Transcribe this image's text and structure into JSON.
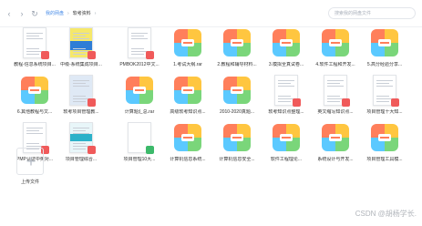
{
  "toolbar": {
    "back_icon": "chevron-left-icon",
    "forward_icon": "chevron-right-icon",
    "refresh_icon": "refresh-icon",
    "breadcrumb": [
      "我的网盘",
      "软考资料"
    ],
    "search_placeholder": "搜索我的网盘文件"
  },
  "files": [
    {
      "name": "教程-信息系统项目...",
      "kind": "doc",
      "cover": "plain"
    },
    {
      "name": "中级-系统集成项目...",
      "kind": "doc",
      "cover": "yellow"
    },
    {
      "name": "PMBOK2012中文...",
      "kind": "doc",
      "cover": "plain"
    },
    {
      "name": "1.考试大纲.rar",
      "kind": "app"
    },
    {
      "name": "2.教程和辅导材料...",
      "kind": "app"
    },
    {
      "name": "3.模拟全真试卷...",
      "kind": "app"
    },
    {
      "name": "4.软件工程和开发...",
      "kind": "app"
    },
    {
      "name": "5.高分经验分享...",
      "kind": "app"
    },
    {
      "name": "6.其他教程与文...",
      "kind": "app"
    },
    {
      "name": "软考项目管理教...",
      "kind": "doc",
      "cover": "blue"
    },
    {
      "name": "计算题汇总.rar",
      "kind": "app"
    },
    {
      "name": "高级软考知识点...",
      "kind": "app"
    },
    {
      "name": "2010-2020真题...",
      "kind": "app"
    },
    {
      "name": "软考知识点整理...",
      "kind": "doc",
      "cover": "plain"
    },
    {
      "name": "英文缩写知识点...",
      "kind": "doc",
      "cover": "plain"
    },
    {
      "name": "项目管理十大知...",
      "kind": "doc",
      "cover": "plain"
    },
    {
      "name": "PMP认证中英对...",
      "kind": "doc",
      "cover": "plain"
    },
    {
      "name": "项目管理综合...",
      "kind": "doc",
      "cover": "teal"
    },
    {
      "name": "项目管理10大...",
      "kind": "doc",
      "cover": "blank"
    },
    {
      "name": "计算机信息系统...",
      "kind": "app"
    },
    {
      "name": "计算机信息安全...",
      "kind": "app"
    },
    {
      "name": "软件工程理论...",
      "kind": "app"
    },
    {
      "name": "系统设计与开发...",
      "kind": "app"
    },
    {
      "name": "项目管理工具模...",
      "kind": "app"
    }
  ],
  "upload": {
    "label": "上传文件",
    "icon": "plus-icon"
  },
  "watermark": "CSDN @胡杨学长."
}
